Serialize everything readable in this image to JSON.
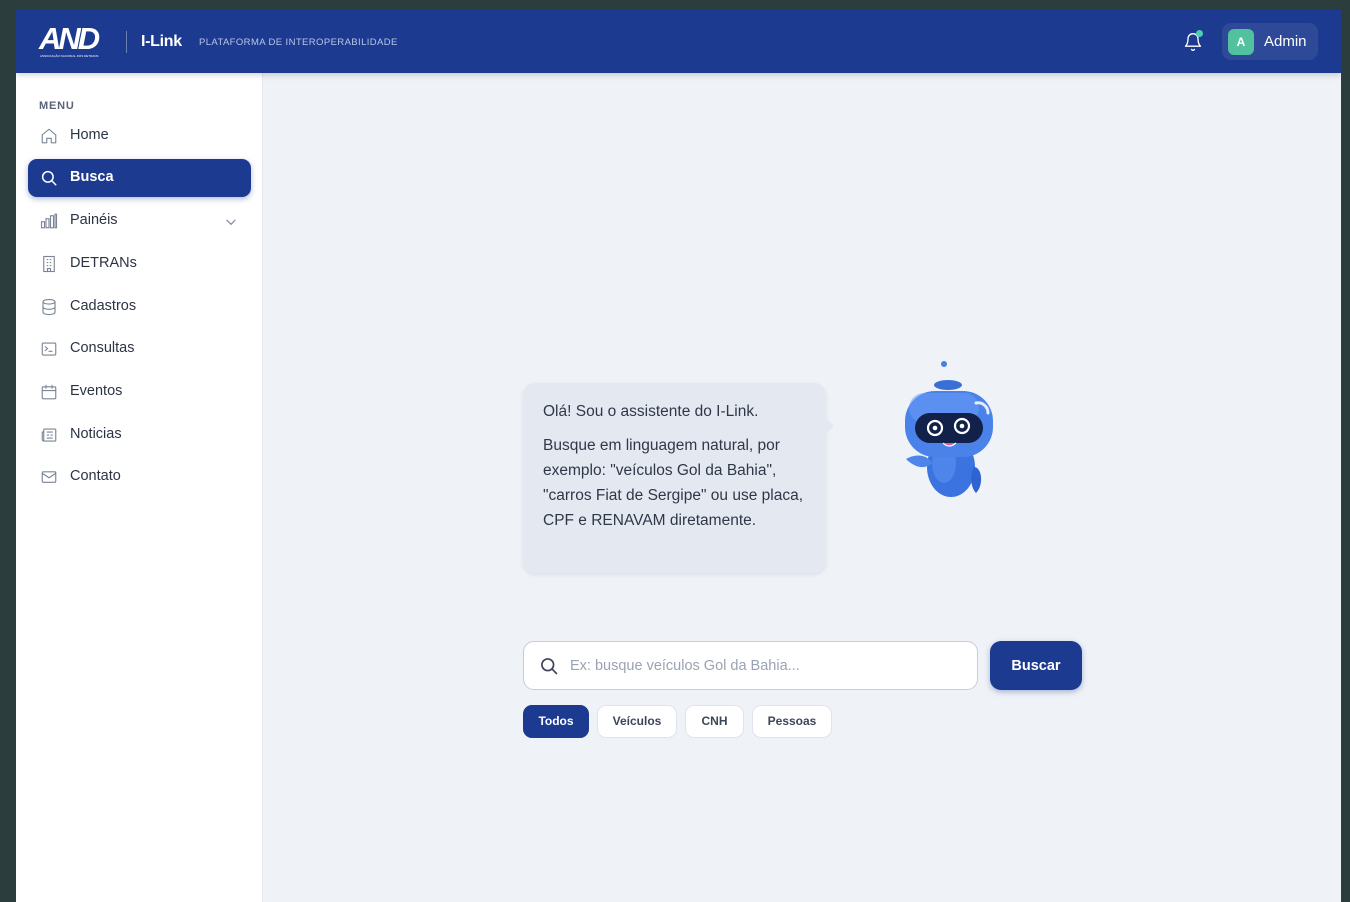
{
  "header": {
    "logo_text": "AND",
    "logo_subtext": "ASSOCIAÇÃO NACIONAL DOS DETRANS",
    "app_name": "I-Link",
    "app_subtitle": "PLATAFORMA DE INTEROPERABILIDADE",
    "notification_icon": "bell-icon",
    "user": {
      "avatar_letter": "A",
      "name": "Admin"
    }
  },
  "sidebar": {
    "menu_title": "MENU",
    "items": [
      {
        "label": "Home",
        "icon": "home-icon",
        "active": false
      },
      {
        "label": "Busca",
        "icon": "search-icon",
        "active": true
      },
      {
        "label": "Painéis",
        "icon": "bar-chart-icon",
        "active": false,
        "expandable": true
      },
      {
        "label": "DETRANs",
        "icon": "building-icon",
        "active": false
      },
      {
        "label": "Cadastros",
        "icon": "database-icon",
        "active": false
      },
      {
        "label": "Consultas",
        "icon": "terminal-icon",
        "active": false
      },
      {
        "label": "Eventos",
        "icon": "calendar-icon",
        "active": false
      },
      {
        "label": "Noticias",
        "icon": "newspaper-icon",
        "active": false
      },
      {
        "label": "Contato",
        "icon": "mail-icon",
        "active": false
      }
    ]
  },
  "assistant": {
    "greeting": "Olá! Sou o assistente do I-Link.",
    "message": "Busque em linguagem natural, por exemplo: \"veículos Gol da Bahia\", \"carros Fiat de Sergipe\" ou use placa, CPF e RENAVAM diretamente."
  },
  "search": {
    "placeholder": "Ex: busque veículos Gol da Bahia...",
    "value": "",
    "button_label": "Buscar"
  },
  "filters": [
    {
      "label": "Todos",
      "active": true
    },
    {
      "label": "Veículos",
      "active": false
    },
    {
      "label": "CNH",
      "active": false
    },
    {
      "label": "Pessoas",
      "active": false
    }
  ],
  "colors": {
    "primary": "#1c3a8f",
    "accent": "#52c29e",
    "background": "#eff2f7"
  }
}
